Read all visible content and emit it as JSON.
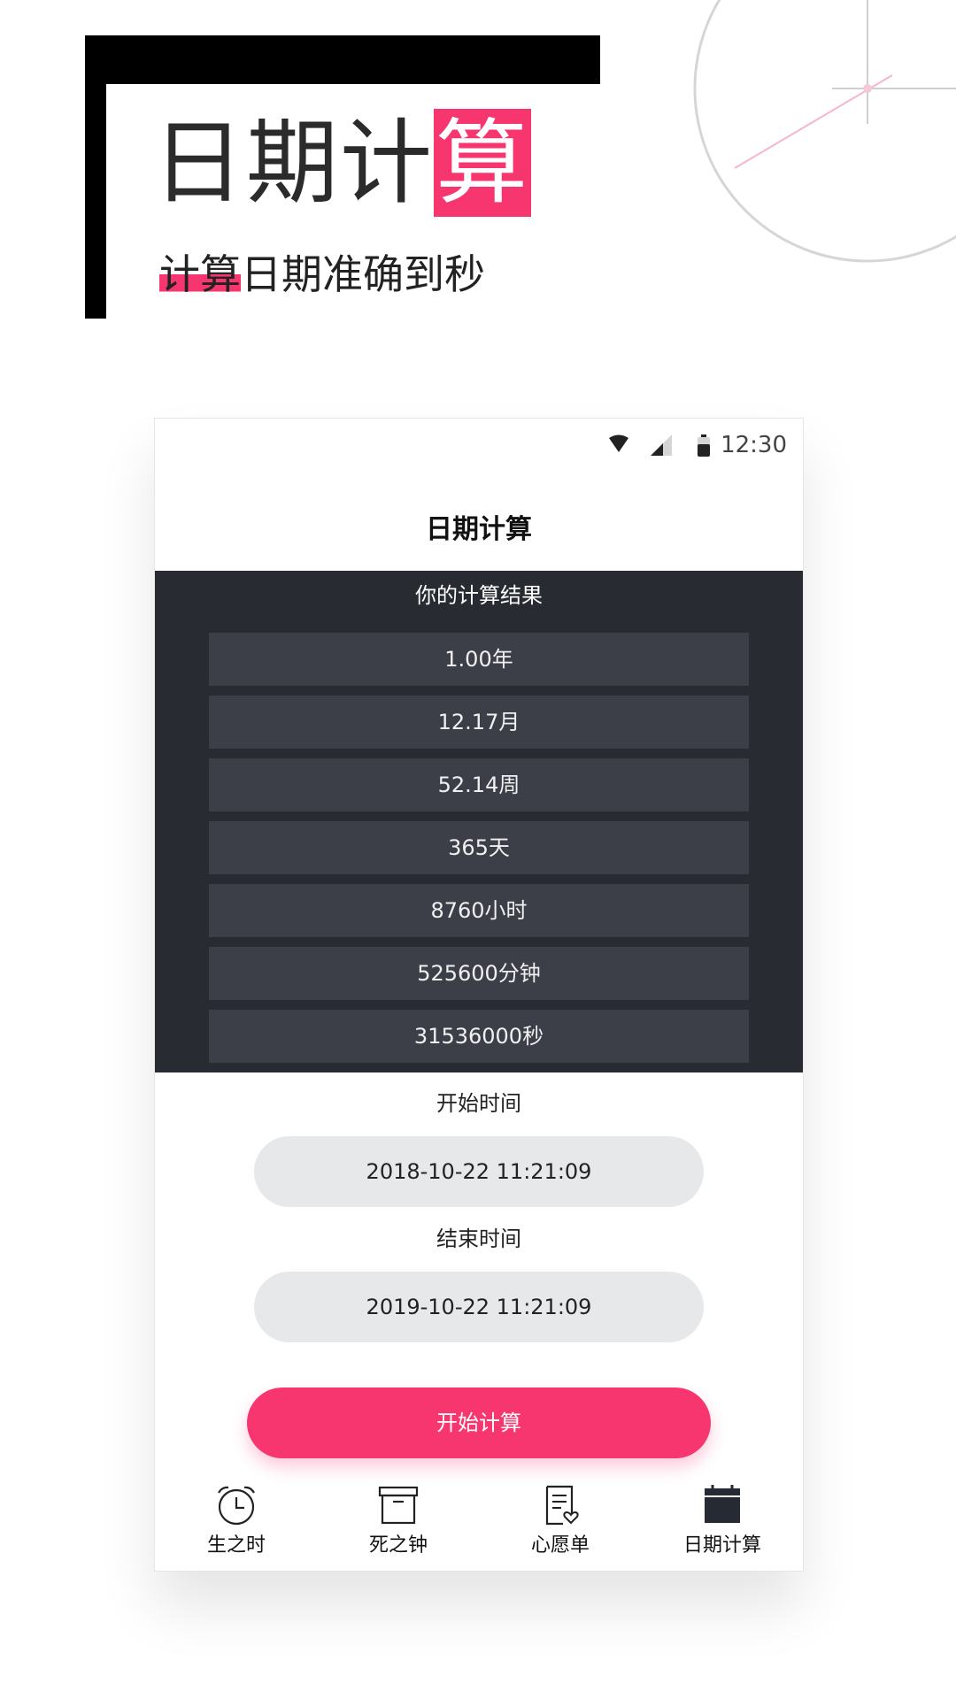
{
  "promo": {
    "title_main": "日期计",
    "title_highlight": "算",
    "subtitle_highlight": "计算",
    "subtitle_rest": "日期准确到秒",
    "accent_color": "#f7356f"
  },
  "status_bar": {
    "time": "12:30",
    "icons": [
      "wifi-icon",
      "signal-icon",
      "battery-icon"
    ]
  },
  "app": {
    "title": "日期计算"
  },
  "results": {
    "heading": "你的计算结果",
    "rows": [
      "1.00年",
      "12.17月",
      "52.14周",
      "365天",
      "8760小时",
      "525600分钟",
      "31536000秒"
    ]
  },
  "form": {
    "start_label": "开始时间",
    "start_value": "2018-10-22 11:21:09",
    "end_label": "结束时间",
    "end_value": "2019-10-22 11:21:09",
    "submit_label": "开始计算"
  },
  "nav": {
    "items": [
      {
        "label": "生之时",
        "icon": "alarm-clock-icon"
      },
      {
        "label": "死之钟",
        "icon": "archive-box-icon"
      },
      {
        "label": "心愿单",
        "icon": "wishlist-icon"
      },
      {
        "label": "日期计算",
        "icon": "calendar-icon",
        "active": true
      }
    ]
  }
}
